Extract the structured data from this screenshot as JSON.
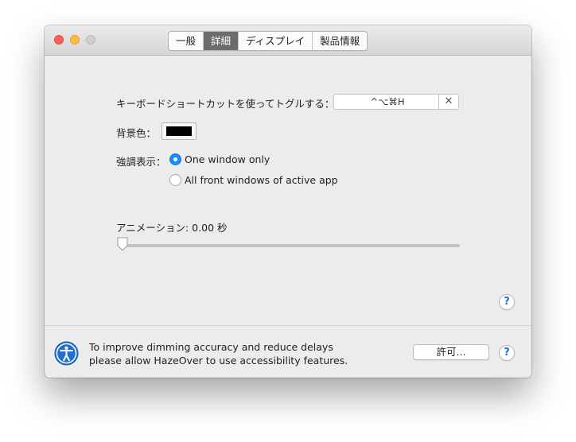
{
  "window": {
    "tabs": [
      {
        "label": "一般",
        "active": false
      },
      {
        "label": "詳細",
        "active": true
      },
      {
        "label": "ディスプレイ",
        "active": false
      },
      {
        "label": "製品情報",
        "active": false
      }
    ]
  },
  "shortcut": {
    "label": "キーボードショートカットを使ってトグルする：",
    "value": "^⌥⌘H",
    "clear_glyph": "✕"
  },
  "background_color": {
    "label": "背景色：",
    "color": "#000000"
  },
  "highlight": {
    "label": "強調表示：",
    "options": [
      {
        "label": "One window only",
        "selected": true
      },
      {
        "label": "All front windows of active app",
        "selected": false
      }
    ]
  },
  "animation": {
    "label": "アニメーション: 0.00 秒",
    "slider_value": 0.0
  },
  "help": {
    "glyph": "?"
  },
  "accessibility": {
    "line1": "To improve dimming accuracy and reduce delays",
    "line2": "please allow HazeOver to use accessibility features.",
    "button_label": "許可..."
  },
  "colors": {
    "accent": "#1a8ef0",
    "active_tab": "#6c6c6c"
  }
}
